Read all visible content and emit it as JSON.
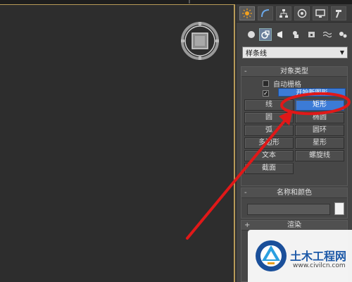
{
  "command_panel": {
    "tabs": [
      {
        "name": "create",
        "icon": "sun-icon",
        "active": true
      },
      {
        "name": "modify",
        "icon": "curve-icon",
        "active": false
      },
      {
        "name": "hierarchy",
        "icon": "hierarchy-icon",
        "active": false
      },
      {
        "name": "motion",
        "icon": "motion-icon",
        "active": false
      },
      {
        "name": "display",
        "icon": "display-icon",
        "active": false
      },
      {
        "name": "utilities",
        "icon": "hammer-icon",
        "active": false
      }
    ],
    "subcategories": [
      {
        "name": "geometry",
        "icon": "sphere-icon",
        "active": false
      },
      {
        "name": "shapes",
        "icon": "shapes-icon",
        "active": true
      },
      {
        "name": "lights",
        "icon": "light-icon",
        "active": false
      },
      {
        "name": "cameras",
        "icon": "camera-icon",
        "active": false
      },
      {
        "name": "helpers",
        "icon": "helper-icon",
        "active": false
      },
      {
        "name": "spacewarps",
        "icon": "wave-icon",
        "active": false
      },
      {
        "name": "systems",
        "icon": "gears-icon",
        "active": false
      }
    ],
    "category_dropdown": {
      "value": "样条线"
    },
    "object_type": {
      "title": "对象类型",
      "toggle": "-",
      "auto_grid_label": "自动栅格",
      "auto_grid_checked": false,
      "start_new_label": "开始新图形",
      "start_new_checked": true,
      "buttons": [
        {
          "label": "线",
          "selected": false
        },
        {
          "label": "矩形",
          "selected": true
        },
        {
          "label": "圆",
          "selected": false
        },
        {
          "label": "椭圆",
          "selected": false
        },
        {
          "label": "弧",
          "selected": false
        },
        {
          "label": "圆环",
          "selected": false
        },
        {
          "label": "多边形",
          "selected": false
        },
        {
          "label": "星形",
          "selected": false
        },
        {
          "label": "文本",
          "selected": false
        },
        {
          "label": "螺旋线",
          "selected": false
        },
        {
          "label": "截面",
          "selected": false
        }
      ]
    },
    "name_color": {
      "title": "名称和颜色",
      "toggle": "-",
      "name_value": "",
      "swatch_color": "#f2f2f2"
    },
    "rendering": {
      "title": "渲染",
      "toggle": "+"
    }
  },
  "annotation": {
    "color": "#e01818"
  },
  "watermark": {
    "title": "土木工程网",
    "url": "www.civilcn.com"
  }
}
